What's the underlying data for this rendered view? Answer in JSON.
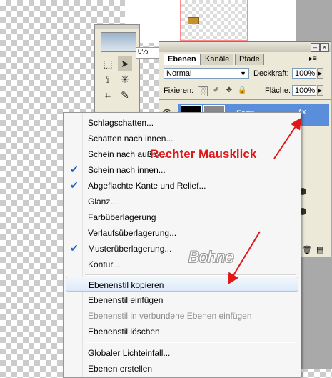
{
  "document": {
    "zoom": "0%"
  },
  "tools": {
    "icons": [
      "marquee-icon",
      "move-icon",
      "lasso-icon",
      "magic-wand-icon",
      "crop-icon",
      "eyedropper-icon"
    ]
  },
  "layers_panel": {
    "tabs": [
      {
        "label": "Ebenen",
        "active": true
      },
      {
        "label": "Kanäle",
        "active": false
      },
      {
        "label": "Pfade",
        "active": false
      }
    ],
    "blend_mode": "Normal",
    "opacity_label": "Deckkraft:",
    "opacity_value": "100%",
    "lock_label": "Fixieren:",
    "fill_label": "Fläche:",
    "fill_value": "100%",
    "layer_name": "Form"
  },
  "context_menu": {
    "items": [
      {
        "label": "Schlagschatten...",
        "checked": false
      },
      {
        "label": "Schatten nach innen...",
        "checked": false
      },
      {
        "label": "Schein nach außen...",
        "checked": false
      },
      {
        "label": "Schein nach innen...",
        "checked": true
      },
      {
        "label": "Abgeflachte Kante und Relief...",
        "checked": true
      },
      {
        "label": "Glanz...",
        "checked": false
      },
      {
        "label": "Farbüberlagerung",
        "checked": false
      },
      {
        "label": "Verlaufsüberlagerung...",
        "checked": false
      },
      {
        "label": "Musterüberlagerung...",
        "checked": true
      },
      {
        "label": "Kontur...",
        "checked": false
      },
      {
        "label": "Ebenenstil kopieren",
        "checked": false,
        "highlighted": true
      },
      {
        "label": "Ebenenstil einfügen",
        "checked": false
      },
      {
        "label": "Ebenenstil in verbundene Ebenen einfügen",
        "checked": false,
        "disabled": true
      },
      {
        "label": "Ebenenstil löschen",
        "checked": false
      },
      {
        "label": "Globaler Lichteinfall...",
        "checked": false
      },
      {
        "label": "Ebenen erstellen",
        "checked": false
      }
    ]
  },
  "annotation": {
    "text": "Rechter Mausklick",
    "color": "#e01818"
  },
  "watermark": {
    "text": "Bohne"
  }
}
